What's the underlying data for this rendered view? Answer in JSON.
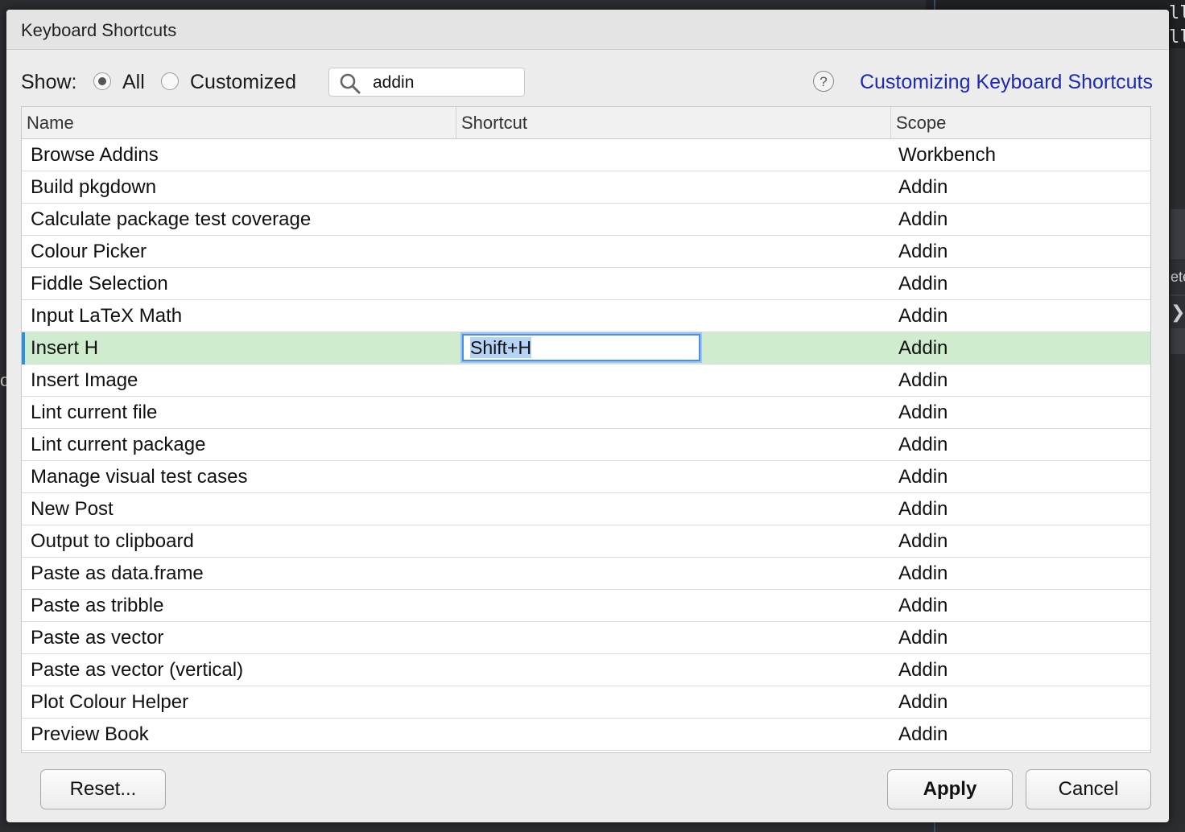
{
  "background": {
    "code_fragments": [
      "ll",
      "ll"
    ],
    "right_fragment": "ete",
    "right_arrow": "❯",
    "left_fragment": "c"
  },
  "dialog": {
    "title": "Keyboard Shortcuts"
  },
  "filter": {
    "show_label": "Show:",
    "options": [
      {
        "label": "All",
        "checked": true
      },
      {
        "label": "Customized",
        "checked": false
      }
    ],
    "search_value": "addin",
    "search_icon": "search-icon",
    "help_icon": "?",
    "help_link": "Customizing Keyboard Shortcuts"
  },
  "table": {
    "columns": [
      "Name",
      "Shortcut",
      "Scope"
    ],
    "rows": [
      {
        "name": "Browse Addins",
        "shortcut": "",
        "scope": "Workbench"
      },
      {
        "name": "Build pkgdown",
        "shortcut": "",
        "scope": "Addin"
      },
      {
        "name": "Calculate package test coverage",
        "shortcut": "",
        "scope": "Addin"
      },
      {
        "name": "Colour Picker",
        "shortcut": "",
        "scope": "Addin"
      },
      {
        "name": "Fiddle Selection",
        "shortcut": "",
        "scope": "Addin"
      },
      {
        "name": "Input LaTeX Math",
        "shortcut": "",
        "scope": "Addin"
      },
      {
        "name": "Insert H",
        "shortcut": "Shift+H",
        "scope": "Addin",
        "selected": true
      },
      {
        "name": "Insert Image",
        "shortcut": "",
        "scope": "Addin"
      },
      {
        "name": "Lint current file",
        "shortcut": "",
        "scope": "Addin"
      },
      {
        "name": "Lint current package",
        "shortcut": "",
        "scope": "Addin"
      },
      {
        "name": "Manage visual test cases",
        "shortcut": "",
        "scope": "Addin"
      },
      {
        "name": "New Post",
        "shortcut": "",
        "scope": "Addin"
      },
      {
        "name": "Output to clipboard",
        "shortcut": "",
        "scope": "Addin"
      },
      {
        "name": "Paste as data.frame",
        "shortcut": "",
        "scope": "Addin"
      },
      {
        "name": "Paste as tribble",
        "shortcut": "",
        "scope": "Addin"
      },
      {
        "name": "Paste as vector",
        "shortcut": "",
        "scope": "Addin"
      },
      {
        "name": "Paste as vector (vertical)",
        "shortcut": "",
        "scope": "Addin"
      },
      {
        "name": "Plot Colour Helper",
        "shortcut": "",
        "scope": "Addin"
      },
      {
        "name": "Preview Book",
        "shortcut": "",
        "scope": "Addin"
      }
    ]
  },
  "buttons": {
    "reset": "Reset...",
    "apply": "Apply",
    "cancel": "Cancel"
  },
  "colors": {
    "selected_row": "#cfeccf",
    "link": "#1d2bb0",
    "focus": "#4a8fe7"
  }
}
